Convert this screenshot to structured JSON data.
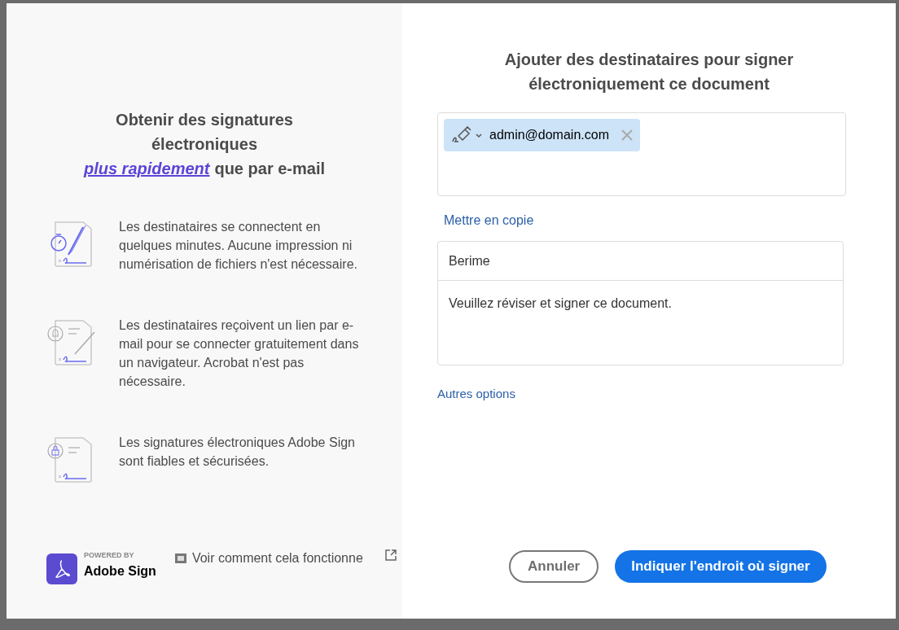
{
  "left_panel": {
    "heading_lines": [
      "Obtenir des signatures",
      "électroniques"
    ],
    "heading_link": "plus rapidement",
    "heading_rest": "que par e-mail",
    "features": [
      {
        "kind": "timer",
        "text": "Les destinataires se connectent en quelques minutes. Aucune impression ni numérisation de fichiers n'est nécessaire."
      },
      {
        "kind": "bell",
        "text": "Les destinataires reçoivent un lien par e-mail pour se connecter gratuitement dans un navigateur. Acrobat n'est pas nécessaire."
      },
      {
        "kind": "lock",
        "text": "Les signatures électroniques Adobe Sign sont fiables et sécurisées."
      }
    ],
    "logo": {
      "powered_by": "POWERED BY",
      "name": "Adobe Sign"
    },
    "video_link": "Voir comment cela fonctionne"
  },
  "right_panel": {
    "title": "Ajouter des destinataires pour signer électroniquement ce document",
    "recipients": [
      {
        "email": "admin@domain.com"
      }
    ],
    "cc_link": "Mettre en copie",
    "subject": "Berime",
    "message": "Veuillez réviser et signer ce document.",
    "more_options": "Autres options",
    "buttons": [
      {
        "kind": "secondary",
        "label": "Annuler"
      },
      {
        "kind": "primary",
        "label": "Indiquer l'endroit où signer"
      }
    ]
  }
}
